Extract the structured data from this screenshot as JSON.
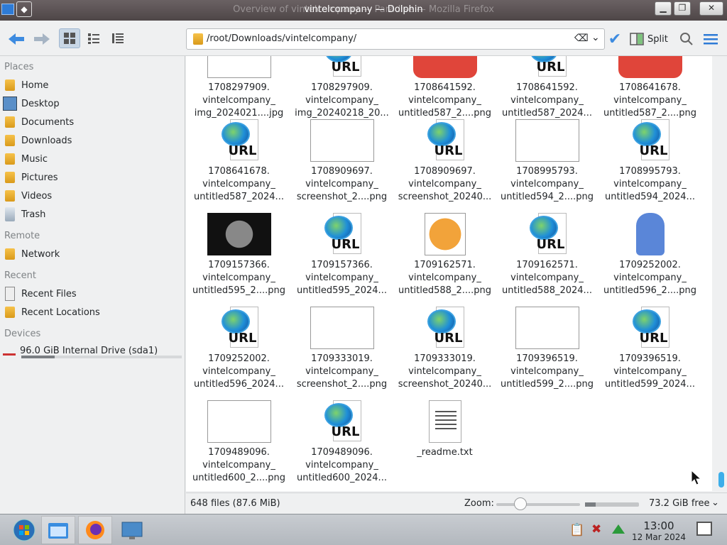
{
  "window": {
    "ghost_title": "Overview of vintelcompany — Paradise — Mozilla Firefox",
    "title": "vintelcompany — Dolphin"
  },
  "toolbar": {
    "location_path": "/root/Downloads/vintelcompany/",
    "split_label": "Split"
  },
  "sidebar": {
    "places_header": "Places",
    "places": [
      "Home",
      "Desktop",
      "Documents",
      "Downloads",
      "Music",
      "Pictures",
      "Videos",
      "Trash"
    ],
    "remote_header": "Remote",
    "remote": [
      "Network"
    ],
    "recent_header": "Recent",
    "recent": [
      "Recent Files",
      "Recent Locations"
    ],
    "devices_header": "Devices",
    "devices": [
      "96.0 GiB Internal Drive (sda1)"
    ],
    "drive_usage_fraction": 0.21
  },
  "files": [
    {
      "l1": "1708297909.",
      "l2": "vintelcompany_",
      "l3": "img_2024021....jpg",
      "kind": "image"
    },
    {
      "l1": "1708297909.",
      "l2": "vintelcompany_",
      "l3": "img_20240218_20...",
      "kind": "url"
    },
    {
      "l1": "1708641592.",
      "l2": "vintelcompany_",
      "l3": "untitled587_2....png",
      "kind": "image-red"
    },
    {
      "l1": "1708641592.",
      "l2": "vintelcompany_",
      "l3": "untitled587_2024...",
      "kind": "url"
    },
    {
      "l1": "1708641678.",
      "l2": "vintelcompany_",
      "l3": "untitled587_2....png",
      "kind": "image-red"
    },
    {
      "l1": "1708641678.",
      "l2": "vintelcompany_",
      "l3": "untitled587_2024...",
      "kind": "url"
    },
    {
      "l1": "1708909697.",
      "l2": "vintelcompany_",
      "l3": "screenshot_2....png",
      "kind": "image"
    },
    {
      "l1": "1708909697.",
      "l2": "vintelcompany_",
      "l3": "screenshot_20240...",
      "kind": "url"
    },
    {
      "l1": "1708995793.",
      "l2": "vintelcompany_",
      "l3": "untitled594_2....png",
      "kind": "image"
    },
    {
      "l1": "1708995793.",
      "l2": "vintelcompany_",
      "l3": "untitled594_2024...",
      "kind": "url"
    },
    {
      "l1": "1709157366.",
      "l2": "vintelcompany_",
      "l3": "untitled595_2....png",
      "kind": "image-dark"
    },
    {
      "l1": "1709157366.",
      "l2": "vintelcompany_",
      "l3": "untitled595_2024...",
      "kind": "url"
    },
    {
      "l1": "1709162571.",
      "l2": "vintelcompany_",
      "l3": "untitled588_2....png",
      "kind": "image-orange"
    },
    {
      "l1": "1709162571.",
      "l2": "vintelcompany_",
      "l3": "untitled588_2024...",
      "kind": "url"
    },
    {
      "l1": "1709252002.",
      "l2": "vintelcompany_",
      "l3": "untitled596_2....png",
      "kind": "image-blue"
    },
    {
      "l1": "1709252002.",
      "l2": "vintelcompany_",
      "l3": "untitled596_2024...",
      "kind": "url"
    },
    {
      "l1": "1709333019.",
      "l2": "vintelcompany_",
      "l3": "screenshot_2....png",
      "kind": "image"
    },
    {
      "l1": "1709333019.",
      "l2": "vintelcompany_",
      "l3": "screenshot_20240...",
      "kind": "url"
    },
    {
      "l1": "1709396519.",
      "l2": "vintelcompany_",
      "l3": "untitled599_2....png",
      "kind": "image"
    },
    {
      "l1": "1709396519.",
      "l2": "vintelcompany_",
      "l3": "untitled599_2024...",
      "kind": "url"
    },
    {
      "l1": "1709489096.",
      "l2": "vintelcompany_",
      "l3": "untitled600_2....png",
      "kind": "image"
    },
    {
      "l1": "1709489096.",
      "l2": "vintelcompany_",
      "l3": "untitled600_2024...",
      "kind": "url"
    },
    {
      "l1": "_readme.txt",
      "l2": "",
      "l3": "",
      "kind": "text"
    }
  ],
  "status": {
    "summary": "648 files (87.6 MiB)",
    "zoom_label": "Zoom:",
    "free_space": "73.2 GiB free",
    "free_usage_fraction": 0.2
  },
  "taskbar": {
    "time": "13:00",
    "date": "12 Mar 2024"
  },
  "colors": {
    "accent": "#3daee9",
    "selection": "#c9d7e6"
  }
}
